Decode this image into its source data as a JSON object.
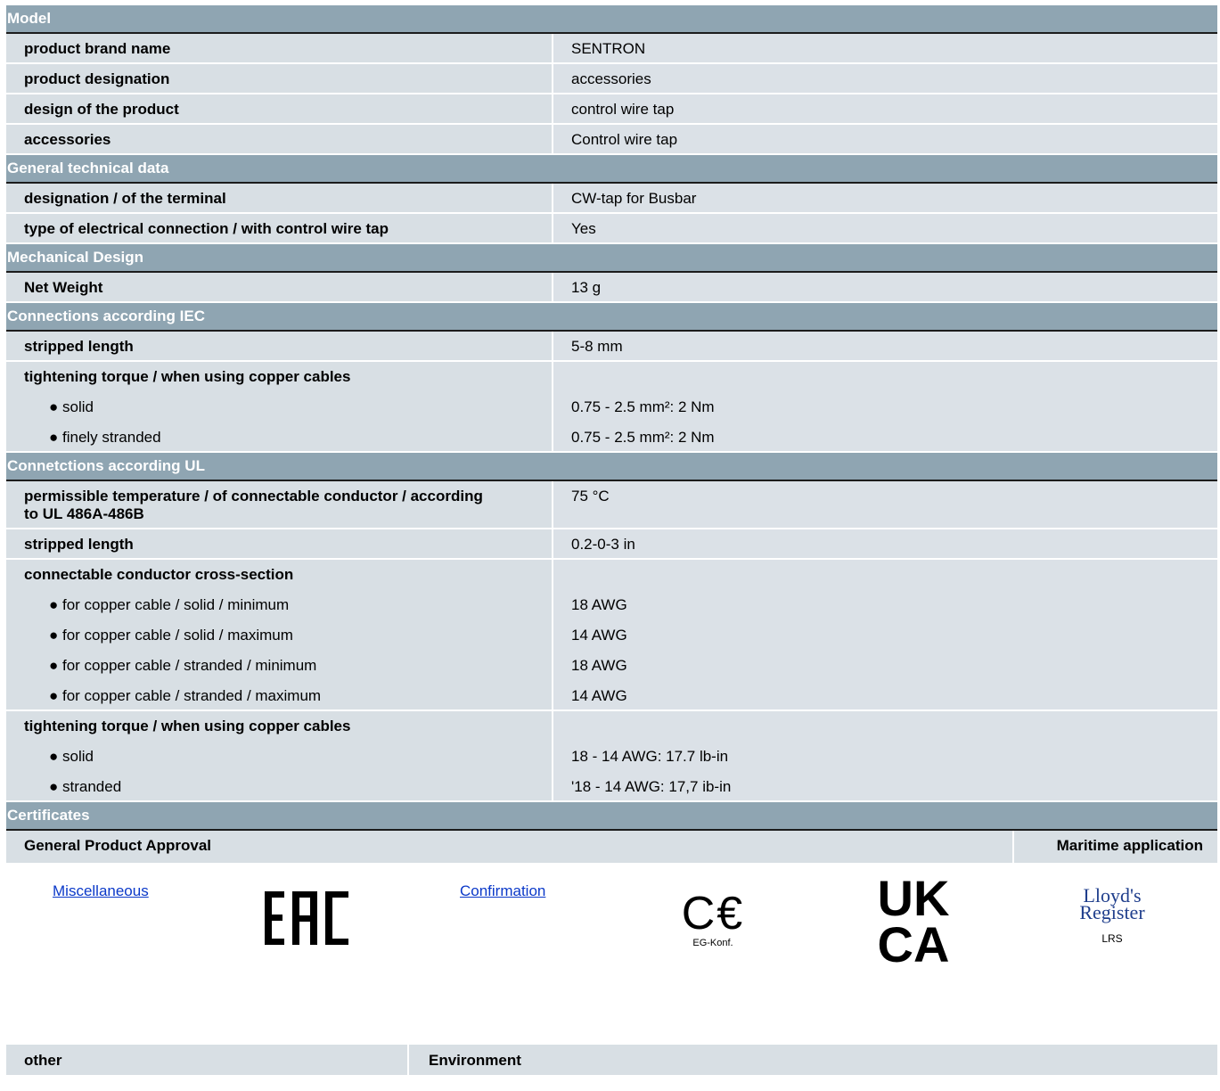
{
  "sections": {
    "model": {
      "title": "Model",
      "rows": [
        {
          "label": "product brand name",
          "value": "SENTRON"
        },
        {
          "label": "product designation",
          "value": "accessories"
        },
        {
          "label": "design of the product",
          "value": "control wire tap"
        },
        {
          "label": "accessories",
          "value": "Control wire tap"
        }
      ]
    },
    "general": {
      "title": "General technical data",
      "rows": [
        {
          "label": "designation / of the terminal",
          "value": "CW-tap for Busbar"
        },
        {
          "label": "type of electrical connection / with control wire tap",
          "value": "Yes"
        }
      ]
    },
    "mechanical": {
      "title": "Mechanical Design",
      "rows": [
        {
          "label": "Net Weight",
          "value": "13 g"
        }
      ]
    },
    "iec": {
      "title": "Connections according IEC",
      "stripped_label": "stripped length",
      "stripped_value": "5-8 mm",
      "torque_label": "tightening torque / when using copper cables",
      "sub": [
        {
          "label": "● solid",
          "value": "0.75 - 2.5 mm²: 2 Nm"
        },
        {
          "label": "● finely stranded",
          "value": "0.75 - 2.5 mm²: 2 Nm"
        }
      ]
    },
    "ul": {
      "title": "Connetctions according UL",
      "temp_label": "permissible temperature / of connectable conductor / according to UL 486A-486B",
      "temp_value": "75 °C",
      "stripped_label": "stripped length",
      "stripped_value": "0.2-0-3 in",
      "cross_label": "connectable conductor cross-section",
      "cross_sub": [
        {
          "label": "● for copper cable / solid / minimum",
          "value": "18 AWG"
        },
        {
          "label": "● for copper cable / solid / maximum",
          "value": "14 AWG"
        },
        {
          "label": "● for copper cable / stranded / minimum",
          "value": "18 AWG"
        },
        {
          "label": "● for copper cable / stranded / maximum",
          "value": "14 AWG"
        }
      ],
      "torque_label": "tightening torque / when using copper cables",
      "torque_sub": [
        {
          "label": "● solid",
          "value": "18 - 14 AWG: 17.7 lb-in"
        },
        {
          "label": "● stranded",
          "value": "'18 - 14 AWG: 17,7 ib-in"
        }
      ]
    }
  },
  "certificates": {
    "title": "Certificates",
    "col1": "General Product Approval",
    "col2": "Maritime application",
    "link1": "Miscellaneous",
    "link2": "Confirmation",
    "logo_eac": "EAC",
    "logo_ce_sub": "EG-Konf.",
    "logo_uk_top": "UK",
    "logo_uk_bottom": "CA",
    "logo_lloyds_1": "Lloyd's",
    "logo_lloyds_2": "Register",
    "logo_lloyds_sub": "LRS"
  },
  "bottom": {
    "other": "other",
    "environment": "Environment"
  }
}
